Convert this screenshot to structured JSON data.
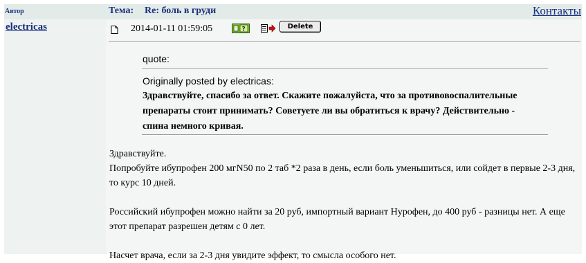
{
  "header": {
    "author_column": "Автор",
    "topic_label": "Тема:",
    "topic_title": "Re: боль в груди",
    "contacts_link": "Контакты"
  },
  "post": {
    "author": "electricas",
    "date": "2014-01-11 01:59:05",
    "delete_label": "Delete",
    "icons": [
      "document-icon",
      "profile-icon",
      "quote-reply-icon"
    ],
    "quote": {
      "label": "quote:",
      "originally_posted": "Originally posted by electricas:",
      "text": "Здравствуйте, спасибо за ответ. Скажите пожалуйста, что за противовоспалительные препараты стоит принимать? Советуете ли вы обратиться к врачу? Действительно - спина немного кривая."
    },
    "reply": {
      "p1": "Здравствуйте.",
      "p1b": "Попробуйте ибупрофен 200 мгN50 по 2 таб *2 раза в день, если боль уменьшиться, или сойдет в первые 2-3 дня, то курс 10 дней.",
      "p2": "Российский ибупрофен можно найти за 20 руб, импортный вариант Нурофен, до 400 руб - разницы нет. А еще этот препарат разрешен детям с 0 лет.",
      "p3": "Насчет врача, если за 2-3 дня увидите эффект, то смысла особого нет."
    }
  },
  "colors": {
    "header_background": "#e2ebe7",
    "link": "#1a2f80",
    "post_background": "#f4f6f5",
    "author_background": "#eef3f1"
  }
}
